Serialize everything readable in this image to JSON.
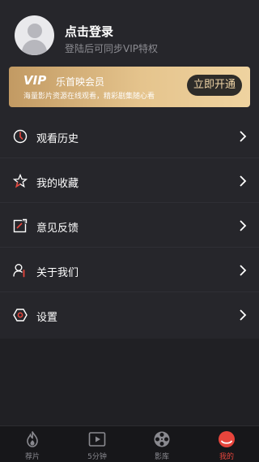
{
  "profile": {
    "title": "点击登录",
    "subtitle": "登陆后可同步VIP特权"
  },
  "vip": {
    "logo": "VIP",
    "name": "乐首映会员",
    "desc": "海量影片资源在线观看，精彩剧集随心看",
    "button": "立即开通"
  },
  "menu": [
    {
      "label": "观看历史",
      "icon": "history-icon"
    },
    {
      "label": "我的收藏",
      "icon": "star-icon"
    },
    {
      "label": "意见反馈",
      "icon": "feedback-icon"
    },
    {
      "label": "关于我们",
      "icon": "about-icon"
    },
    {
      "label": "设置",
      "icon": "settings-icon"
    }
  ],
  "tabbar": [
    {
      "label": "荐片",
      "icon": "flame-icon"
    },
    {
      "label": "5分钟",
      "icon": "video-icon"
    },
    {
      "label": "影库",
      "icon": "film-reel-icon"
    },
    {
      "label": "我的",
      "icon": "profile-icon",
      "active": true
    }
  ],
  "colors": {
    "accent": "#e8453c",
    "vip_gold": "#e5c48d",
    "background": "#26262b"
  }
}
